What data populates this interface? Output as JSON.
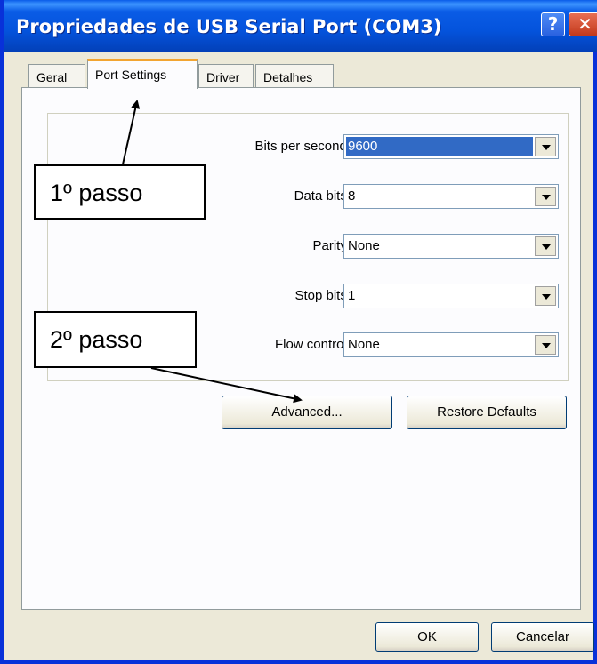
{
  "window": {
    "title": "Propriedades de USB Serial Port (COM3)",
    "help_label": "?",
    "close_label": "✕"
  },
  "tabs": [
    {
      "label": "Geral",
      "active": false
    },
    {
      "label": "Port Settings",
      "active": true
    },
    {
      "label": "Driver",
      "active": false
    },
    {
      "label": "Detalhes",
      "active": false
    }
  ],
  "fields": {
    "bits_per_second": {
      "label": "Bits per second:",
      "value": "9600"
    },
    "data_bits": {
      "label": "Data bits:",
      "value": "8"
    },
    "parity": {
      "label": "Parity:",
      "value": "None"
    },
    "stop_bits": {
      "label": "Stop bits:",
      "value": "1"
    },
    "flow_control": {
      "label": "Flow control:",
      "value": "None"
    }
  },
  "buttons": {
    "advanced": "Advanced...",
    "restore_defaults": "Restore Defaults",
    "ok": "OK",
    "cancel": "Cancelar"
  },
  "annotations": {
    "step1": "1º passo",
    "step2": "2º passo"
  },
  "colors": {
    "titlebar": "#0453dc",
    "selection": "#316ac5",
    "active_tab_accent": "#f2a531",
    "close_button": "#c3391b"
  }
}
